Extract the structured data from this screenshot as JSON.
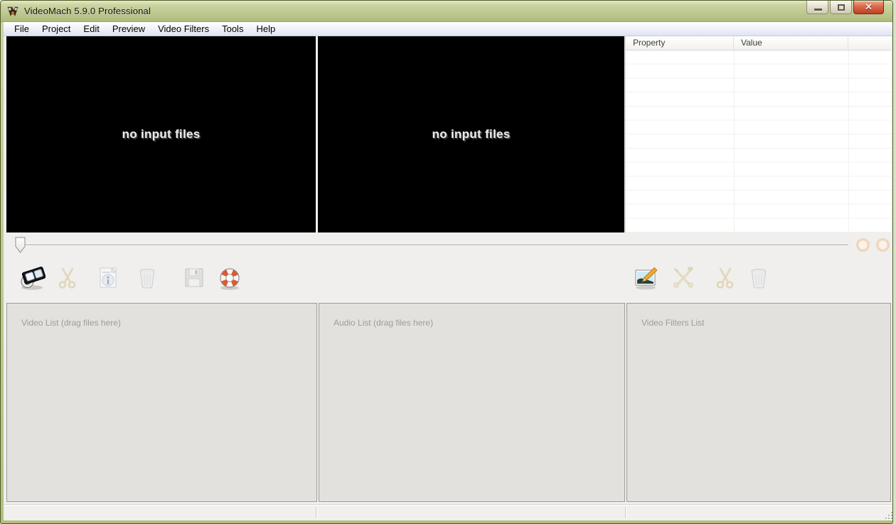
{
  "window": {
    "title": "VideoMach 5.9.0 Professional",
    "controls": {
      "minimize": "minimize",
      "restore": "restore",
      "close": "close"
    }
  },
  "menu": {
    "items": [
      "File",
      "Project",
      "Edit",
      "Preview",
      "Video Filters",
      "Tools",
      "Help"
    ]
  },
  "preview": {
    "left": "no input files",
    "right": "no input files"
  },
  "property_table": {
    "columns": [
      "Property",
      "Value",
      ""
    ],
    "rows": []
  },
  "timeline": {
    "value": 0,
    "nav_buttons": [
      "previous-icon",
      "next-icon"
    ]
  },
  "toolbar_left": {
    "buttons": [
      {
        "icon": "open-media-icon",
        "enabled": true
      },
      {
        "icon": "cut-icon",
        "enabled": false
      },
      {
        "icon": "file-info-icon",
        "enabled": false
      },
      {
        "icon": "delete-icon",
        "enabled": false
      },
      {
        "icon": "save-icon",
        "enabled": false
      },
      {
        "icon": "help-icon",
        "enabled": true
      }
    ]
  },
  "toolbar_right": {
    "buttons": [
      {
        "icon": "add-video-filter-icon",
        "enabled": true
      },
      {
        "icon": "filter-settings-icon",
        "enabled": false
      },
      {
        "icon": "cut-filter-icon",
        "enabled": false
      },
      {
        "icon": "delete-filter-icon",
        "enabled": false
      }
    ]
  },
  "panels": {
    "video_list_label": "Video List (drag files here)",
    "audio_list_label": "Audio List (drag files here)",
    "video_filters_label": "Video Filters List"
  },
  "statusbar": {
    "left": "",
    "middle": "",
    "right": ""
  },
  "colors": {
    "titlebar_green": "#bfca92",
    "close_red": "#c04028",
    "help_orange": "#dd5a2d",
    "menu_gradient_bottom": "#dfe3f2",
    "panel_bg": "#e2e1de",
    "black_pane": "#000000",
    "window_bg": "#f0efee"
  }
}
